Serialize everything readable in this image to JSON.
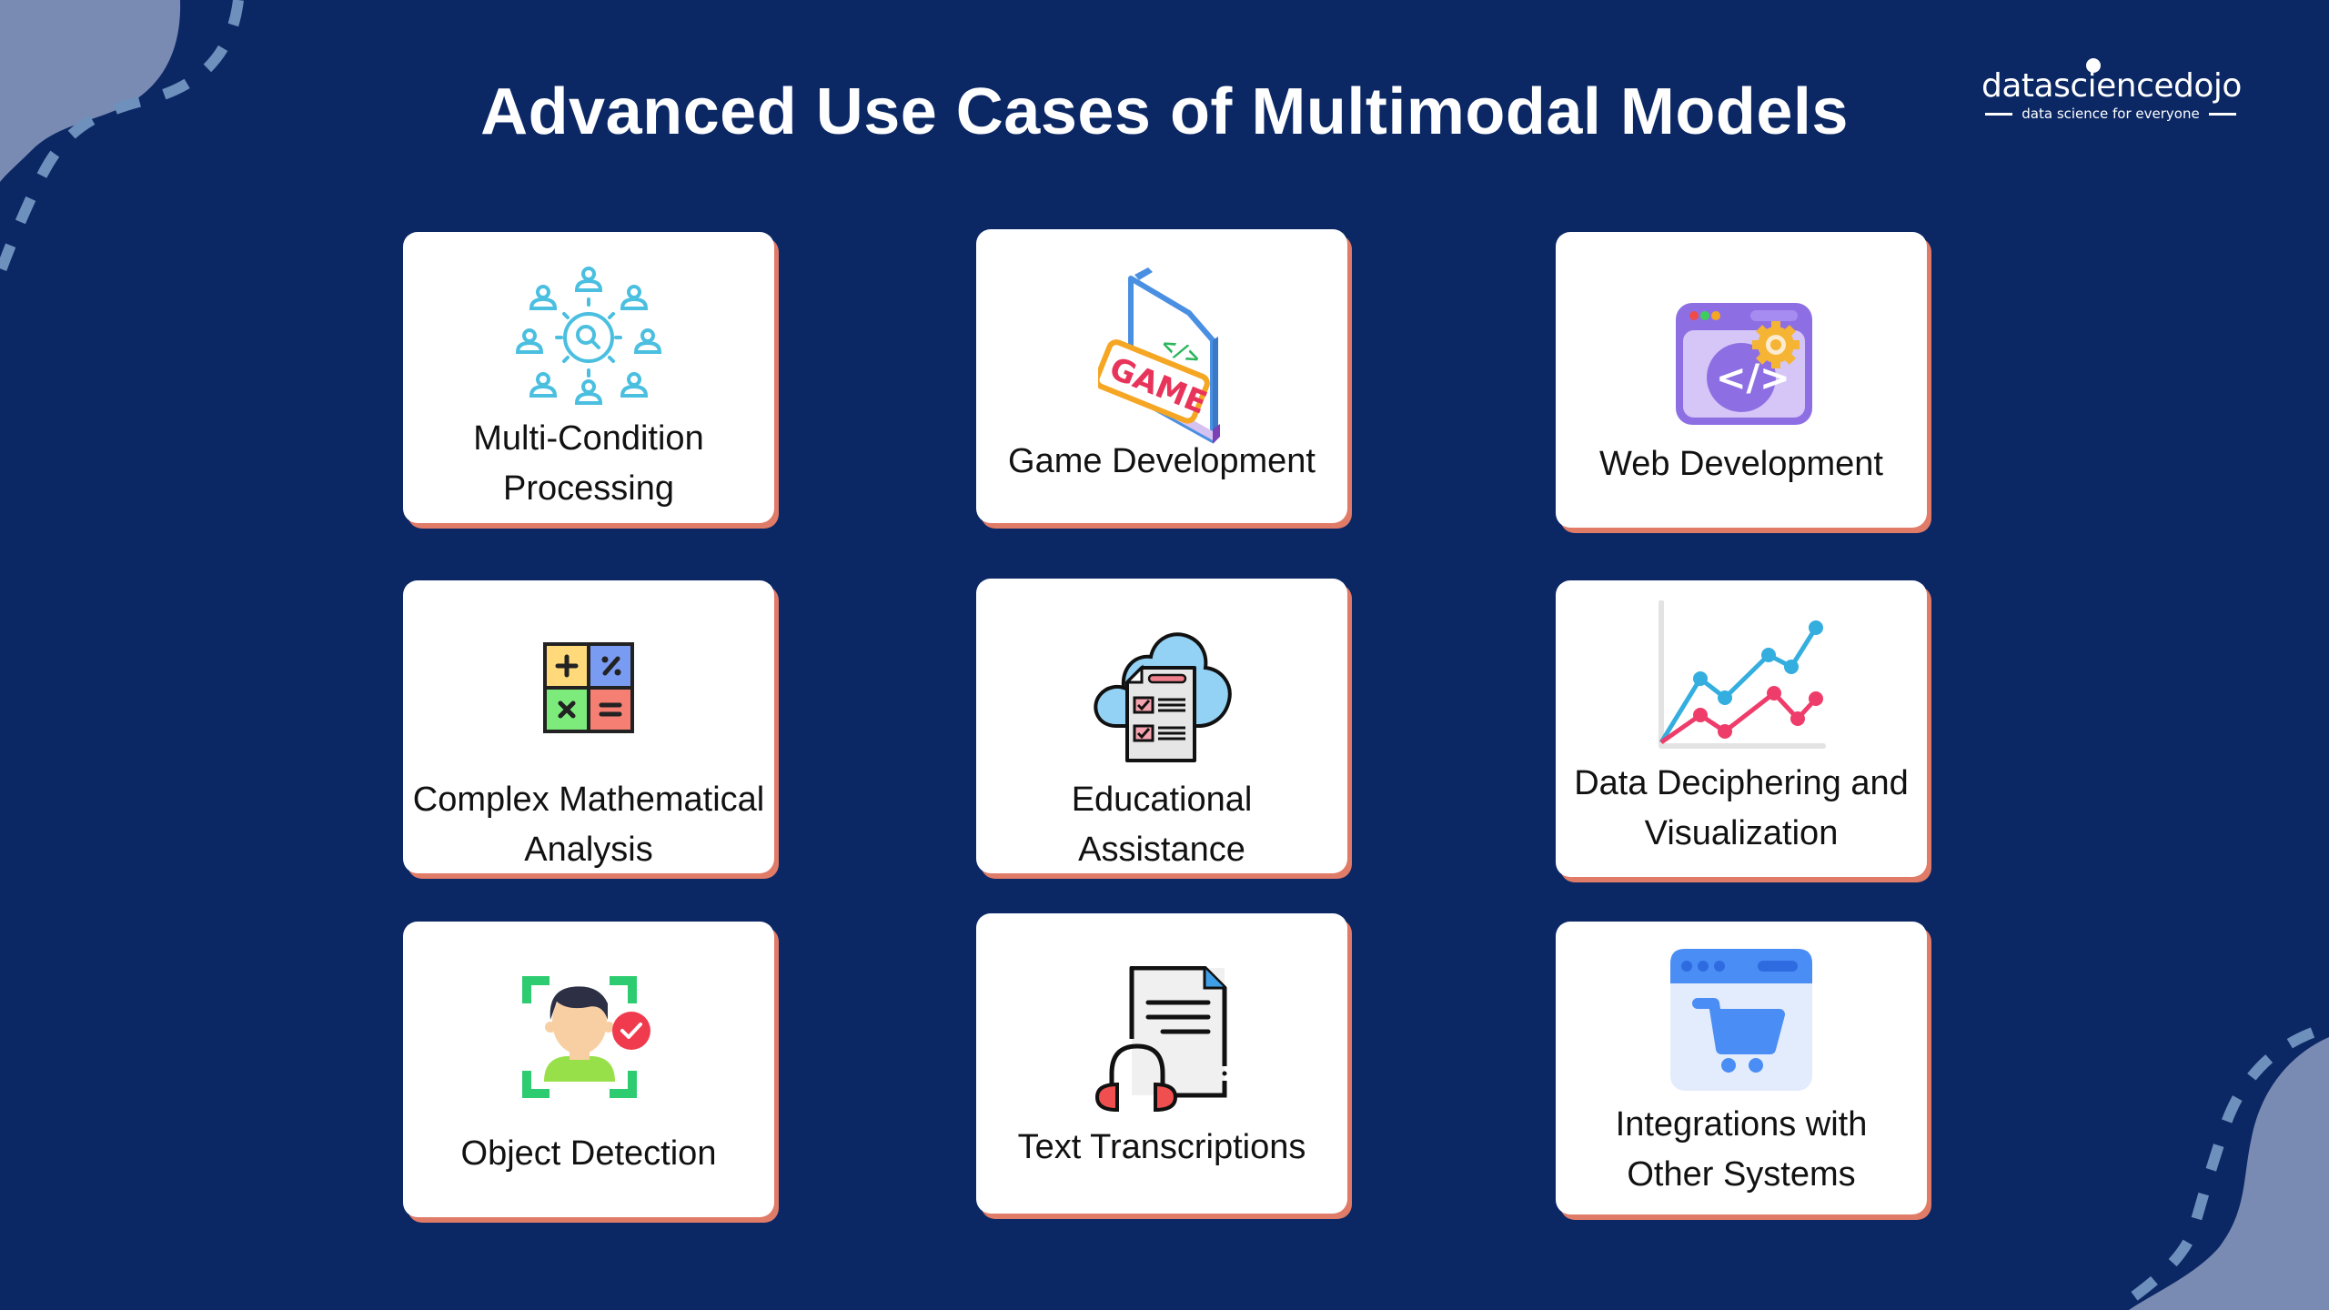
{
  "page": {
    "title": "Advanced Use Cases of Multimodal Models",
    "background_color": "#0B2865",
    "card_shadow_color": "#E07B68"
  },
  "logo": {
    "brand": "datasciencedojo",
    "tagline": "data science for everyone"
  },
  "cards": [
    {
      "label_lines": [
        "Multi-Condition",
        "Processing"
      ],
      "icon": "network-search-icon"
    },
    {
      "label_lines": [
        "Game Development"
      ],
      "icon": "game-file-icon"
    },
    {
      "label_lines": [
        "Web Development"
      ],
      "icon": "web-code-gear-icon"
    },
    {
      "label_lines": [
        "Complex Mathematical",
        "Analysis"
      ],
      "icon": "calculator-operators-icon"
    },
    {
      "label_lines": [
        "Educational",
        "Assistance"
      ],
      "icon": "cloud-checklist-icon"
    },
    {
      "label_lines": [
        "Data Deciphering and",
        "Visualization"
      ],
      "icon": "line-chart-icon"
    },
    {
      "label_lines": [
        "Object Detection"
      ],
      "icon": "face-detection-icon"
    },
    {
      "label_lines": [
        "Text Transcriptions"
      ],
      "icon": "document-headphones-icon"
    },
    {
      "label_lines": [
        "Integrations with",
        "Other Systems"
      ],
      "icon": "browser-cart-icon"
    }
  ]
}
